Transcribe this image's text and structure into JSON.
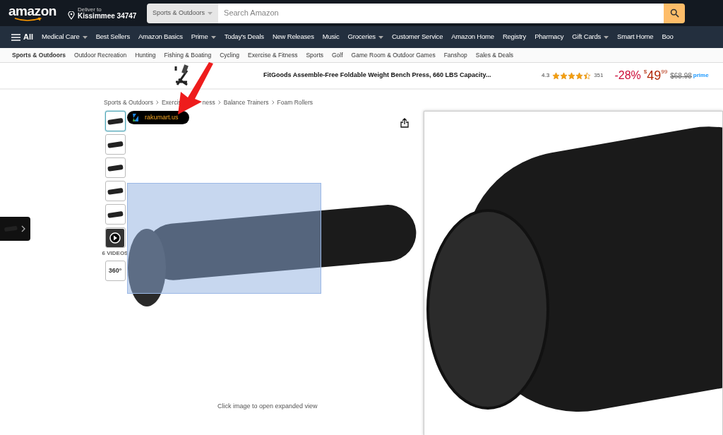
{
  "header": {
    "logo": "amazon",
    "deliver_label": "Deliver to",
    "deliver_location": "Kissimmee 34747",
    "search_category": "Sports & Outdoors",
    "search_placeholder": "Search Amazon"
  },
  "nav": {
    "all_label": "All",
    "items": [
      {
        "label": "Medical Care",
        "dropdown": true
      },
      {
        "label": "Best Sellers",
        "dropdown": false
      },
      {
        "label": "Amazon Basics",
        "dropdown": false
      },
      {
        "label": "Prime",
        "dropdown": true
      },
      {
        "label": "Today's Deals",
        "dropdown": false
      },
      {
        "label": "New Releases",
        "dropdown": false
      },
      {
        "label": "Music",
        "dropdown": false
      },
      {
        "label": "Groceries",
        "dropdown": true
      },
      {
        "label": "Customer Service",
        "dropdown": false
      },
      {
        "label": "Amazon Home",
        "dropdown": false
      },
      {
        "label": "Registry",
        "dropdown": false
      },
      {
        "label": "Pharmacy",
        "dropdown": false
      },
      {
        "label": "Gift Cards",
        "dropdown": true
      },
      {
        "label": "Smart Home",
        "dropdown": false
      },
      {
        "label": "Boo",
        "dropdown": false
      }
    ]
  },
  "subnav": [
    {
      "label": "Sports & Outdoors",
      "selected": true
    },
    {
      "label": "Outdoor Recreation",
      "selected": false
    },
    {
      "label": "Hunting",
      "selected": false
    },
    {
      "label": "Fishing & Boating",
      "selected": false
    },
    {
      "label": "Cycling",
      "selected": false
    },
    {
      "label": "Exercise & Fitness",
      "selected": false
    },
    {
      "label": "Sports",
      "selected": false
    },
    {
      "label": "Golf",
      "selected": false
    },
    {
      "label": "Game Room & Outdoor Games",
      "selected": false
    },
    {
      "label": "Fanshop",
      "selected": false
    },
    {
      "label": "Sales & Deals",
      "selected": false
    }
  ],
  "sponsored": {
    "title": "FitGoods Assemble-Free Foldable Weight Bench Press, 660 LBS Capacity...",
    "rating": "4.3",
    "stars": 4.5,
    "review_count": "351",
    "discount": "-28%",
    "price_symbol": "$",
    "price_whole": "49",
    "price_fraction": "99",
    "list_price": "$68.98",
    "prime": "prime"
  },
  "breadcrumb": [
    {
      "parts": [
        "Sports & Outdoors"
      ]
    },
    {
      "parts": [
        "Exercis",
        "ness"
      ]
    },
    {
      "parts": [
        "Balance Trainers"
      ]
    },
    {
      "parts": [
        "Foam Rollers"
      ]
    }
  ],
  "badge": "rakumart.us",
  "thumbnails": [
    {
      "kind": "image",
      "selected": true
    },
    {
      "kind": "image",
      "selected": false
    },
    {
      "kind": "image",
      "selected": false
    },
    {
      "kind": "image",
      "selected": false
    },
    {
      "kind": "image",
      "selected": false
    },
    {
      "kind": "video",
      "selected": false,
      "caption": "6 VIDEOS"
    },
    {
      "kind": "spin",
      "selected": false,
      "label": "360°"
    }
  ],
  "caption": "Click image to open expanded view"
}
